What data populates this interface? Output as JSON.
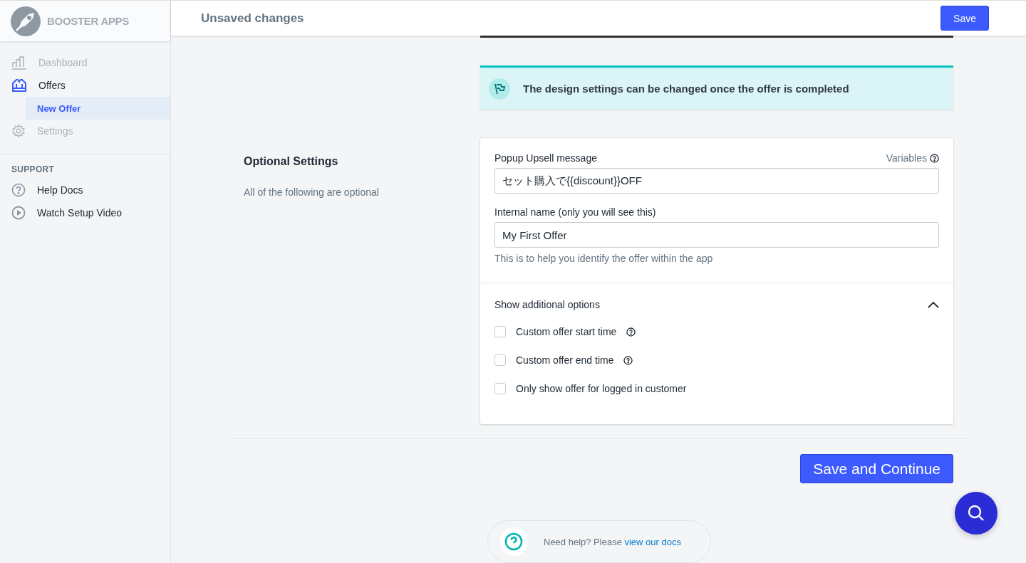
{
  "brand": {
    "name": "BOOSTER APPS"
  },
  "sidebar": {
    "items": [
      {
        "kind": "chart",
        "label": "Dashboard",
        "disabled": true,
        "selected": false
      },
      {
        "kind": "tag",
        "label": "Offers",
        "disabled": false,
        "selected": false,
        "children": [
          {
            "label": "New Offer",
            "selected": true
          }
        ]
      },
      {
        "kind": "gear",
        "label": "Settings",
        "disabled": true,
        "selected": false
      }
    ],
    "support_heading": "SUPPORT",
    "support_items": [
      {
        "kind": "help",
        "label": "Help Docs"
      },
      {
        "kind": "play",
        "label": "Watch Setup Video"
      }
    ]
  },
  "top_bar": {
    "title": "Unsaved changes",
    "button": "Save"
  },
  "notice": {
    "text": "The design settings can be changed once the offer is completed"
  },
  "optional_section": {
    "title": "Optional Settings",
    "description": "All of the following are optional"
  },
  "form": {
    "fields": [
      {
        "label": "Popup Upsell message",
        "aside": "Variables",
        "value": "セット購入で{{discount}}OFF"
      },
      {
        "label": "Internal name (only you will see this)",
        "value": "My First Offer",
        "help": "This is to help you identify the offer within the app"
      }
    ],
    "additional": {
      "title": "Show additional options",
      "expanded": true,
      "options": [
        {
          "label": "Custom offer start time",
          "checked": false,
          "info": true
        },
        {
          "label": "Custom offer end time",
          "checked": false,
          "info": true
        },
        {
          "label": "Only show offer for logged in customer",
          "checked": false,
          "info": false
        }
      ]
    }
  },
  "save_continue": "Save and Continue",
  "help_footer": {
    "text": "Need help? Please",
    "link": "view our docs"
  }
}
